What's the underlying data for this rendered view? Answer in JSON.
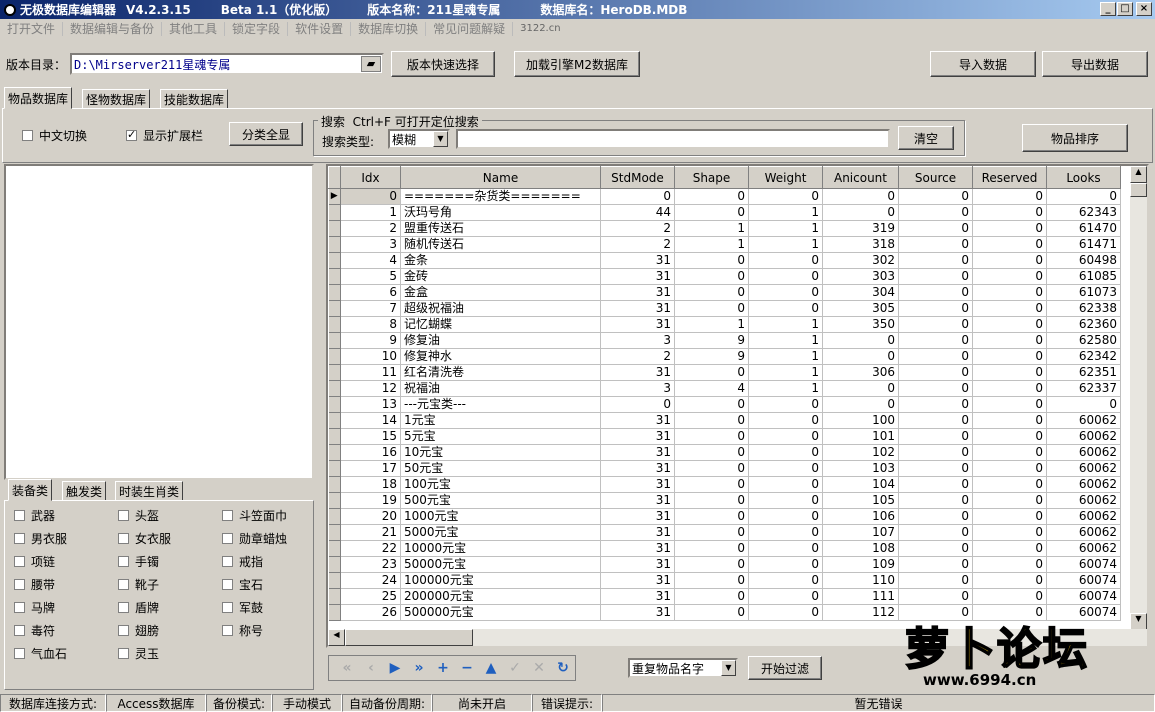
{
  "window": {
    "app": "无极数据库编辑器",
    "ver": "V4.2.3.15",
    "beta": "Beta 1.1（优化版）",
    "verName": "版本名称：211星魂专属",
    "dbName": "数据库名：HeroDB.MDB"
  },
  "menu": [
    "打开文件",
    "数据编辑与备份",
    "其他工具",
    "锁定字段",
    "软件设置",
    "数据库切换",
    "常见问题解疑",
    "3122.cn"
  ],
  "toolbar": {
    "dirLabel": "版本目录：",
    "dirValue": "D:\\Mirserver211星魂专属",
    "quickSelect": "版本快速选择",
    "loadEngine": "加载引擎M2数据库",
    "import": "导入数据",
    "export": "导出数据"
  },
  "tabs": [
    "物品数据库",
    "怪物数据库",
    "技能数据库"
  ],
  "options": {
    "cnSwitch": "中文切换",
    "showExt": "显示扩展栏",
    "showAll": "分类全显"
  },
  "search": {
    "legend": "搜索  Ctrl+F 可打开定位搜索",
    "typeLabel": "搜索类型:",
    "typeValue": "模糊",
    "clear": "清空",
    "sort": "物品排序"
  },
  "catTabs": [
    "装备类",
    "触发类",
    "时装生肖类"
  ],
  "categories": [
    "武器",
    "头盔",
    "斗笠面巾",
    "男衣服",
    "女衣服",
    "勋章蜡烛",
    "项链",
    "手镯",
    "戒指",
    "腰带",
    "靴子",
    "宝石",
    "马牌",
    "盾牌",
    "军鼓",
    "毒符",
    "翅膀",
    "称号",
    "气血石",
    "灵玉"
  ],
  "columns": [
    "Idx",
    "Name",
    "StdMode",
    "Shape",
    "Weight",
    "Anicount",
    "Source",
    "Reserved",
    "Looks"
  ],
  "rows": [
    [
      "0",
      "=======杂货类=======",
      "0",
      "0",
      "0",
      "0",
      "0",
      "0",
      "0"
    ],
    [
      "1",
      "沃玛号角",
      "44",
      "0",
      "1",
      "0",
      "0",
      "0",
      "62343"
    ],
    [
      "2",
      "盟重传送石",
      "2",
      "1",
      "1",
      "319",
      "0",
      "0",
      "61470"
    ],
    [
      "3",
      "随机传送石",
      "2",
      "1",
      "1",
      "318",
      "0",
      "0",
      "61471"
    ],
    [
      "4",
      "金条",
      "31",
      "0",
      "0",
      "302",
      "0",
      "0",
      "60498"
    ],
    [
      "5",
      "金砖",
      "31",
      "0",
      "0",
      "303",
      "0",
      "0",
      "61085"
    ],
    [
      "6",
      "金盒",
      "31",
      "0",
      "0",
      "304",
      "0",
      "0",
      "61073"
    ],
    [
      "7",
      "超级祝福油",
      "31",
      "0",
      "0",
      "305",
      "0",
      "0",
      "62338"
    ],
    [
      "8",
      "记忆蝴蝶",
      "31",
      "1",
      "1",
      "350",
      "0",
      "0",
      "62360"
    ],
    [
      "9",
      "修复油",
      "3",
      "9",
      "1",
      "0",
      "0",
      "0",
      "62580"
    ],
    [
      "10",
      "修复神水",
      "2",
      "9",
      "1",
      "0",
      "0",
      "0",
      "62342"
    ],
    [
      "11",
      "红名清洗卷",
      "31",
      "0",
      "1",
      "306",
      "0",
      "0",
      "62351"
    ],
    [
      "12",
      "祝福油",
      "3",
      "4",
      "1",
      "0",
      "0",
      "0",
      "62337"
    ],
    [
      "13",
      "---元宝类---",
      "0",
      "0",
      "0",
      "0",
      "0",
      "0",
      "0"
    ],
    [
      "14",
      "1元宝",
      "31",
      "0",
      "0",
      "100",
      "0",
      "0",
      "60062"
    ],
    [
      "15",
      "5元宝",
      "31",
      "0",
      "0",
      "101",
      "0",
      "0",
      "60062"
    ],
    [
      "16",
      "10元宝",
      "31",
      "0",
      "0",
      "102",
      "0",
      "0",
      "60062"
    ],
    [
      "17",
      "50元宝",
      "31",
      "0",
      "0",
      "103",
      "0",
      "0",
      "60062"
    ],
    [
      "18",
      "100元宝",
      "31",
      "0",
      "0",
      "104",
      "0",
      "0",
      "60062"
    ],
    [
      "19",
      "500元宝",
      "31",
      "0",
      "0",
      "105",
      "0",
      "0",
      "60062"
    ],
    [
      "20",
      "1000元宝",
      "31",
      "0",
      "0",
      "106",
      "0",
      "0",
      "60062"
    ],
    [
      "21",
      "5000元宝",
      "31",
      "0",
      "0",
      "107",
      "0",
      "0",
      "60062"
    ],
    [
      "22",
      "10000元宝",
      "31",
      "0",
      "0",
      "108",
      "0",
      "0",
      "60062"
    ],
    [
      "23",
      "50000元宝",
      "31",
      "0",
      "0",
      "109",
      "0",
      "0",
      "60074"
    ],
    [
      "24",
      "100000元宝",
      "31",
      "0",
      "0",
      "110",
      "0",
      "0",
      "60074"
    ],
    [
      "25",
      "200000元宝",
      "31",
      "0",
      "0",
      "111",
      "0",
      "0",
      "60074"
    ],
    [
      "26",
      "500000元宝",
      "31",
      "0",
      "0",
      "112",
      "0",
      "0",
      "60074"
    ]
  ],
  "nav": {
    "filterValue": "重复物品名字",
    "filterBtn": "开始过滤"
  },
  "status": [
    "数据库连接方式:",
    "Access数据库",
    "备份模式:",
    "手动模式",
    "自动备份周期:",
    "尚未开启",
    "错误提示:",
    "暂无错误"
  ],
  "logo": {
    "text": "萝卜论坛",
    "url": "www.6994.cn"
  }
}
